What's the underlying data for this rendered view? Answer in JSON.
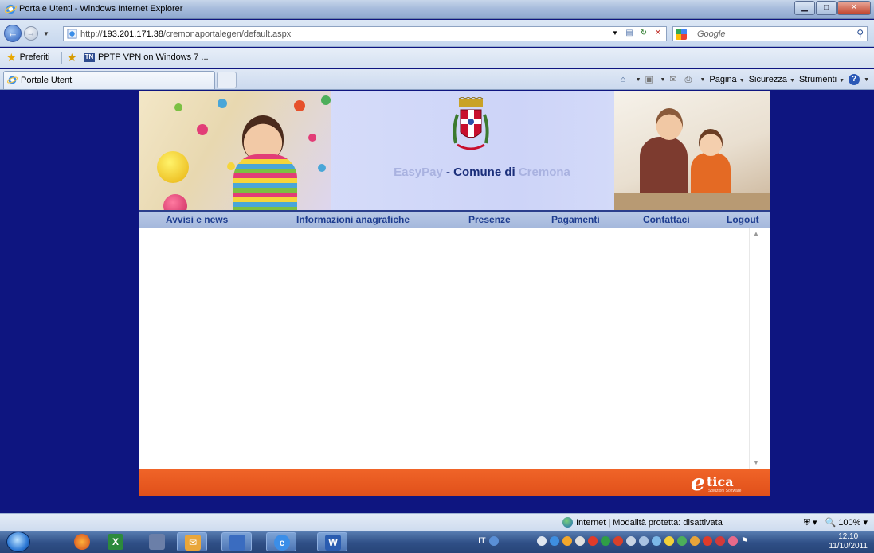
{
  "window": {
    "title": "Portale Utenti - Windows Internet Explorer"
  },
  "address_bar": {
    "url_prefix": "http://",
    "url_host": "193.201.171.38",
    "url_path": "/cremonaportalegen/default.aspx"
  },
  "search": {
    "placeholder": "Google"
  },
  "favorites": {
    "label": "Preferiti",
    "items": [
      {
        "label": "PPTP VPN on Windows 7 ..."
      }
    ]
  },
  "tabs": [
    {
      "label": "Portale Utenti"
    }
  ],
  "commands": {
    "page": "Pagina",
    "security": "Sicurezza",
    "tools": "Strumenti"
  },
  "portal": {
    "title_prefix": "EasyPay",
    "title_main": " - Comune di ",
    "title_city": "Cremona",
    "menu": [
      {
        "label": "Avvisi e news"
      },
      {
        "label": "Informazioni anagrafiche"
      },
      {
        "label": "Presenze"
      },
      {
        "label": "Pagamenti"
      },
      {
        "label": "Contattaci"
      },
      {
        "label": "Logout"
      }
    ],
    "footer_brand": "tica",
    "footer_brand_initial": "e",
    "footer_tagline": "Soluzioni Software"
  },
  "status_bar": {
    "zone": "Internet | Modalità protetta: disattivata",
    "zoom": "100%"
  },
  "taskbar": {
    "language": "IT",
    "time": "12.10",
    "date": "11/10/2011"
  },
  "colors": {
    "page_bg": "#0e1580",
    "menu_text": "#1d3c8f",
    "footer": "#f06428"
  }
}
